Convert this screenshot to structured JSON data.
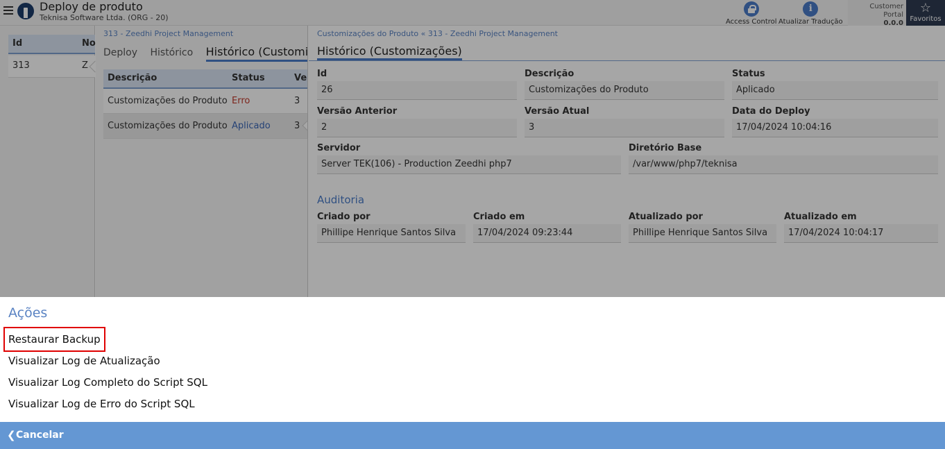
{
  "header": {
    "title": "Deploy de produto",
    "subtitle": "Teknisa Software Ltda. (ORG - 20)",
    "actions": [
      {
        "label": "Access Control",
        "icon": "lock-icon"
      },
      {
        "label": "Atualizar Tradução",
        "icon": "info-icon"
      }
    ],
    "customer_portal": {
      "label": "Customer Portal",
      "version": "0.0.0"
    },
    "favoritos": {
      "label": "Favoritos",
      "icon": "star-icon"
    }
  },
  "left_grid": {
    "columns": [
      "Id",
      "No"
    ],
    "rows": [
      {
        "id": "313",
        "name": "Z"
      }
    ]
  },
  "middle": {
    "breadcrumb": "313 - Zeedhi Project Management",
    "tabs": [
      "Deploy",
      "Histórico",
      "Histórico (Customizações)"
    ],
    "columns": [
      "Descrição",
      "Status",
      "Ver"
    ],
    "rows": [
      {
        "descricao": "Customizações do Produto",
        "status": "Erro",
        "versao": "3"
      },
      {
        "descricao": "Customizações do Produto",
        "status": "Aplicado",
        "versao": "3"
      }
    ]
  },
  "detail": {
    "breadcrumb": "Customizações do Produto  «  313 - Zeedhi Project Management",
    "title": "Histórico (Customizações)",
    "fields": {
      "id": {
        "label": "Id",
        "value": "26"
      },
      "descricao": {
        "label": "Descrição",
        "value": "Customizações do Produto"
      },
      "status": {
        "label": "Status",
        "value": "Aplicado"
      },
      "versao_anterior": {
        "label": "Versão Anterior",
        "value": "2"
      },
      "versao_atual": {
        "label": "Versão Atual",
        "value": "3"
      },
      "data_deploy": {
        "label": "Data do Deploy",
        "value": "17/04/2024 10:04:16"
      },
      "servidor": {
        "label": "Servidor",
        "value": "Server TEK(106) - Production Zeedhi php7"
      },
      "diretorio": {
        "label": "Diretório Base",
        "value": "/var/www/php7/teknisa"
      }
    },
    "auditoria": {
      "title": "Auditoria",
      "criado_por": {
        "label": "Criado por",
        "value": "Phillipe Henrique Santos Silva"
      },
      "criado_em": {
        "label": "Criado em",
        "value": "17/04/2024 09:23:44"
      },
      "atualizado_por": {
        "label": "Atualizado por",
        "value": "Phillipe Henrique Santos Silva"
      },
      "atualizado_em": {
        "label": "Atualizado em",
        "value": "17/04/2024 10:04:17"
      }
    }
  },
  "actions_sheet": {
    "title": "Ações",
    "items": [
      "Restaurar Backup",
      "Visualizar Log de Atualização",
      "Visualizar Log Completo do Script SQL",
      "Visualizar Log de Erro do Script SQL"
    ],
    "cancel": "Cancelar"
  },
  "colors": {
    "accent": "#4a7cc8",
    "cancel_bar": "#6497d3",
    "highlight": "#e00000",
    "error": "#c0392b"
  }
}
